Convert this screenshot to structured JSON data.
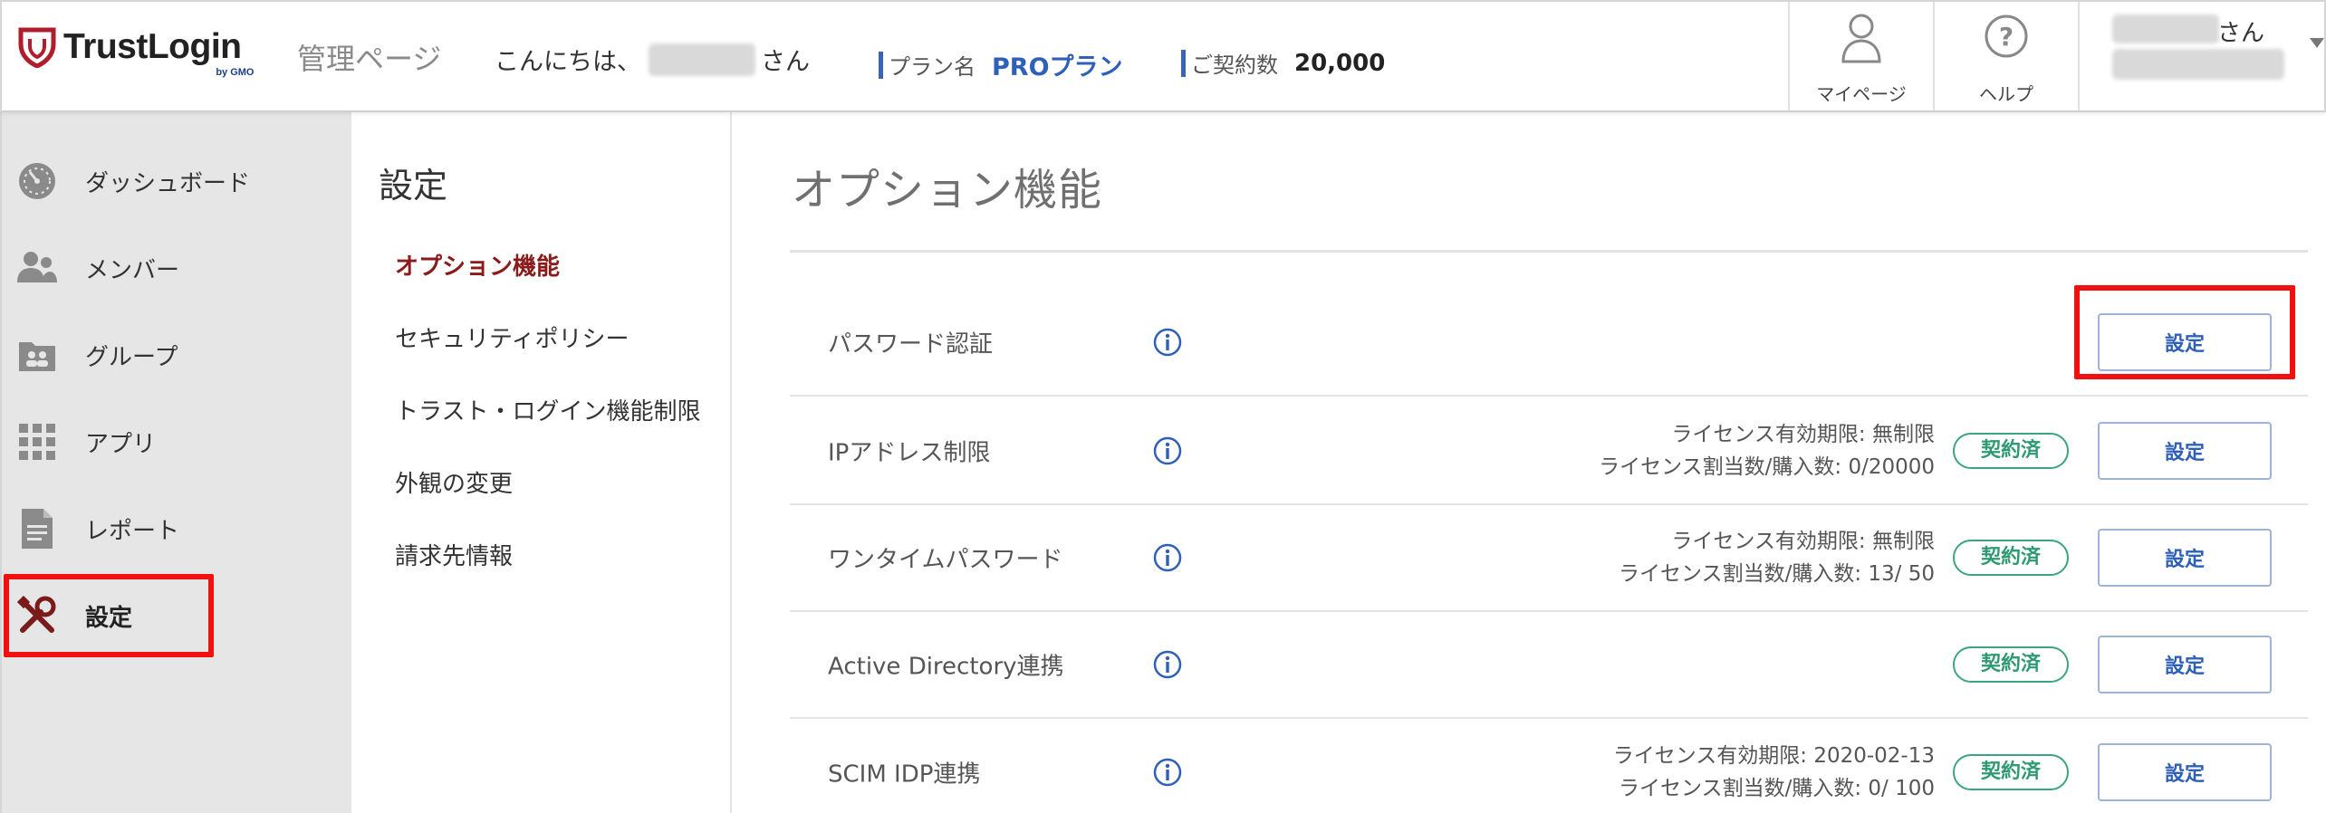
{
  "header": {
    "logo_text": "TrustLogin",
    "logo_by": "by GMO",
    "admin_title": "管理ページ",
    "greeting_prefix": "こんにちは、",
    "greeting_suffix": "さん",
    "plan_label": "プラン名",
    "plan_value": "PROプラン",
    "contract_label": "ご契約数",
    "contract_value": "20,000",
    "mypage_label": "マイページ",
    "help_label": "ヘルプ",
    "user_suffix": "さん",
    "accent_color": "#2f60b8",
    "logo_color": "#b01e2e"
  },
  "sidebar": {
    "items": [
      {
        "label": "ダッシュボード",
        "icon": "dashboard-gauge-icon"
      },
      {
        "label": "メンバー",
        "icon": "members-icon"
      },
      {
        "label": "グループ",
        "icon": "group-folder-icon"
      },
      {
        "label": "アプリ",
        "icon": "apps-grid-icon"
      },
      {
        "label": "レポート",
        "icon": "report-document-icon"
      },
      {
        "label": "設定",
        "icon": "settings-tools-icon",
        "active": true
      }
    ]
  },
  "submenu": {
    "title": "設定",
    "items": [
      {
        "label": "オプション機能",
        "active": true
      },
      {
        "label": "セキュリティポリシー"
      },
      {
        "label": "トラスト・ログイン機能制限"
      },
      {
        "label": "外観の変更"
      },
      {
        "label": "請求先情報"
      }
    ]
  },
  "main": {
    "title": "オプション機能",
    "badge_label": "契約済",
    "button_label": "設定",
    "badge_color": "#2e9a72",
    "highlight_color": "#f01010",
    "rows": [
      {
        "name": "パスワード認証",
        "meta1": "",
        "meta2": "",
        "badge": false
      },
      {
        "name": "IPアドレス制限",
        "meta1": "ライセンス有効期限: 無制限",
        "meta2": "ライセンス割当数/購入数: 0/20000",
        "badge": true
      },
      {
        "name": "ワンタイムパスワード",
        "meta1": "ライセンス有効期限: 無制限",
        "meta2": "ライセンス割当数/購入数: 13/ 50",
        "badge": true
      },
      {
        "name": "Active Directory連携",
        "meta1": "",
        "meta2": "",
        "badge": true
      },
      {
        "name": "SCIM IDP連携",
        "meta1": "ライセンス有効期限: 2020-02-13",
        "meta2": "ライセンス割当数/購入数: 0/ 100",
        "badge": true
      }
    ]
  }
}
